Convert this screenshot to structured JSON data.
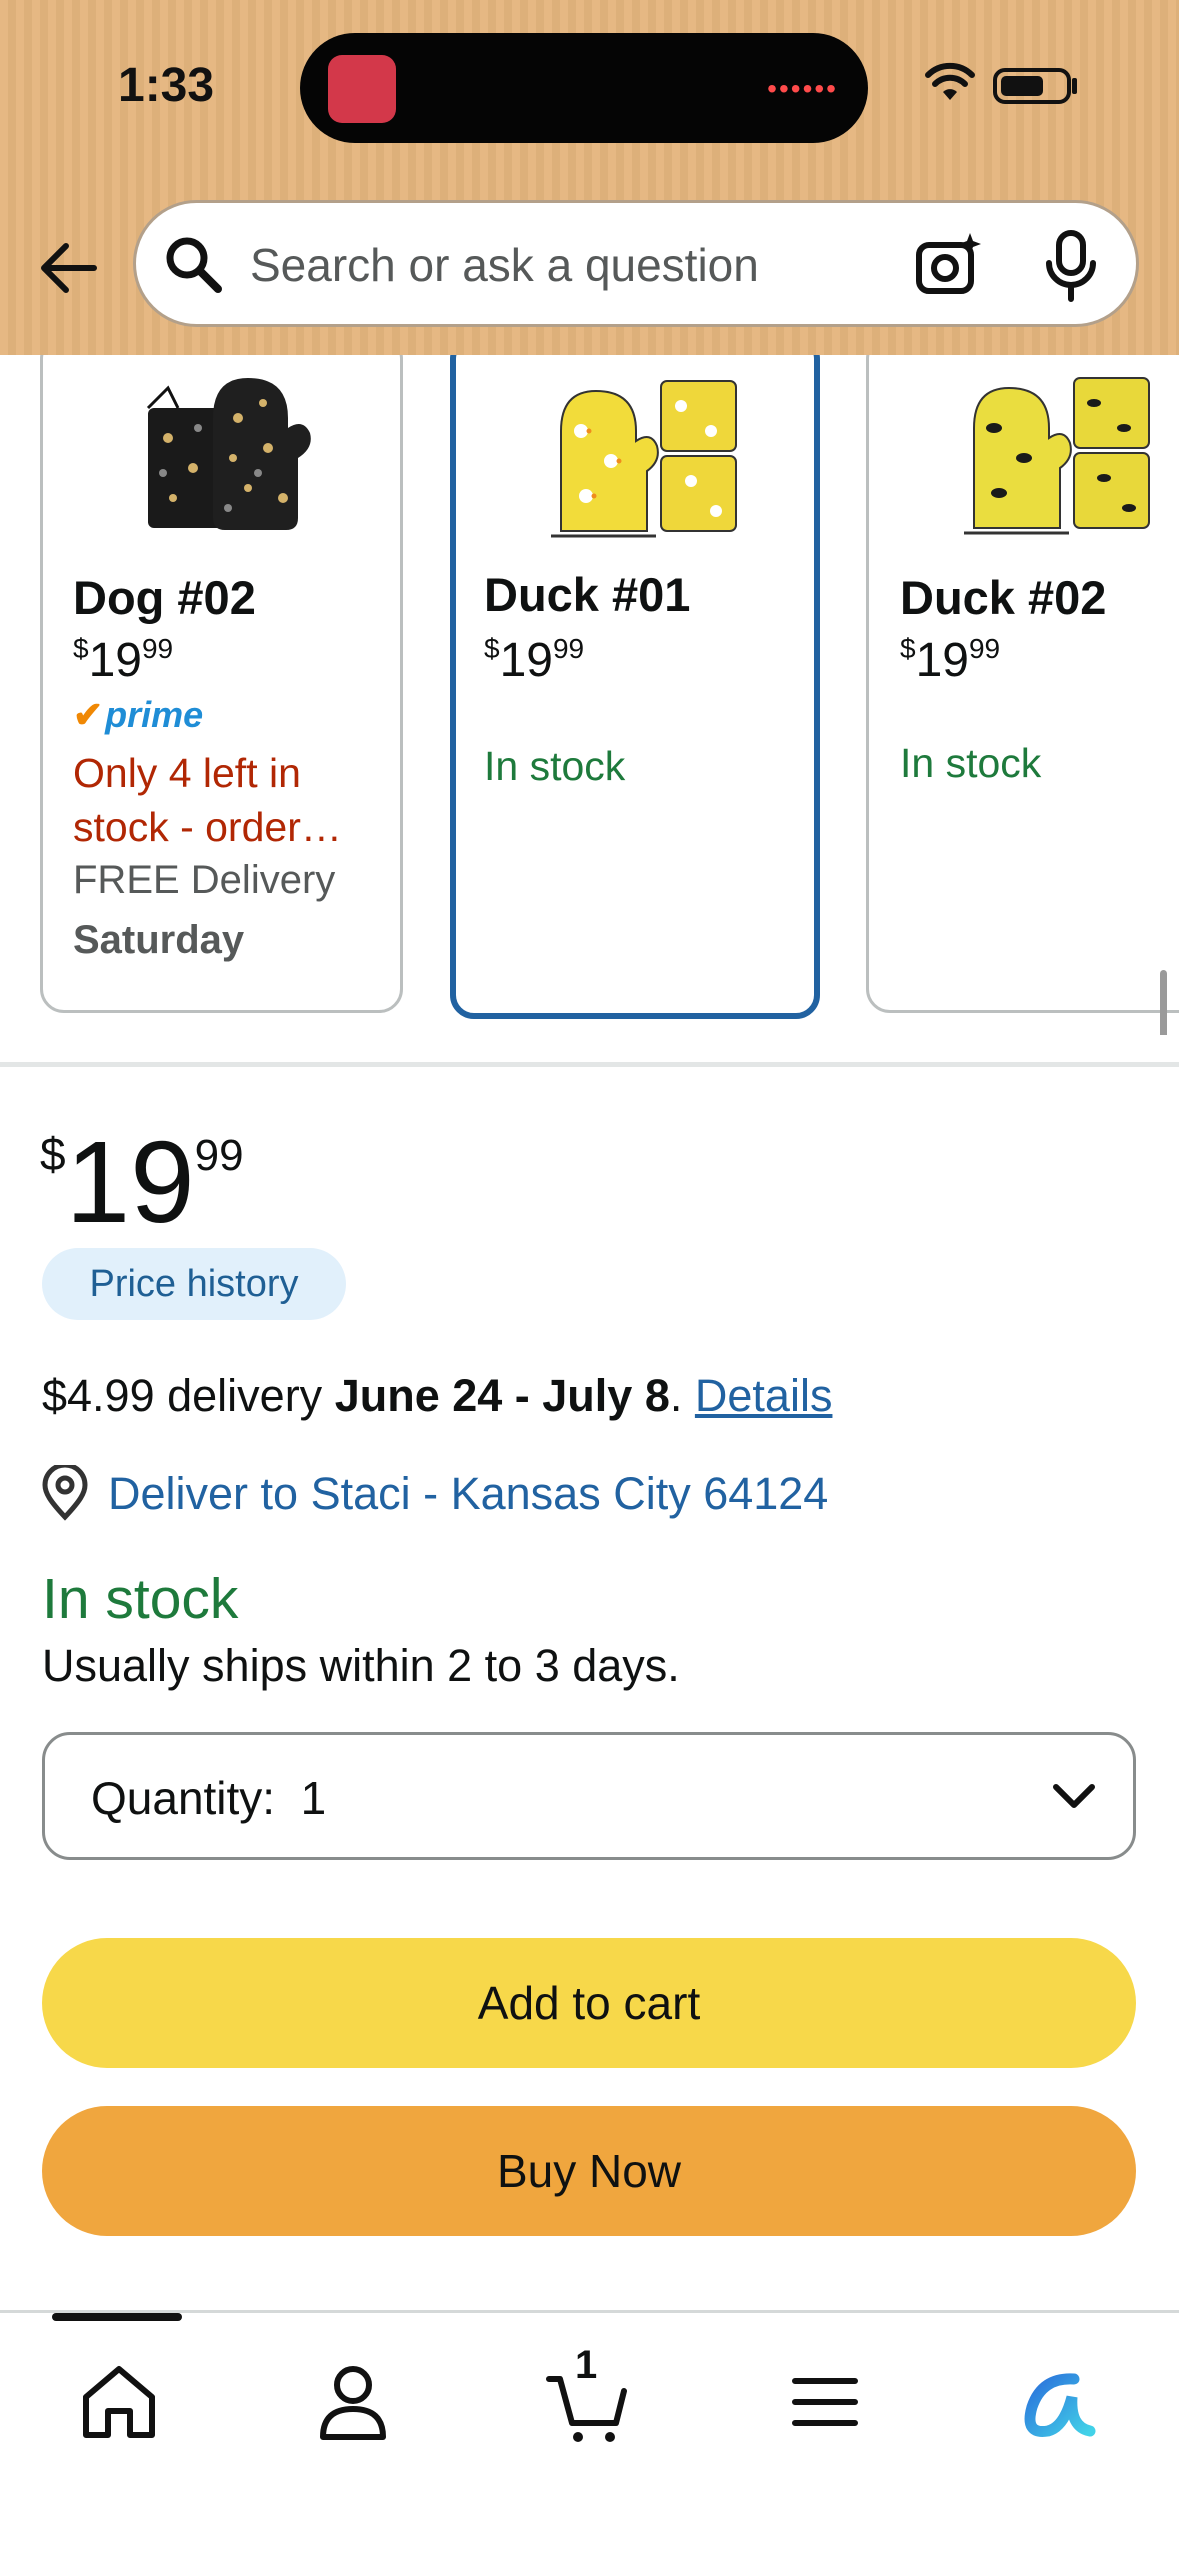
{
  "status_bar": {
    "time": "1:33"
  },
  "search": {
    "placeholder": "Search or ask a question"
  },
  "variants": [
    {
      "name": "Dog #02",
      "price_currency": "$",
      "price_whole": "19",
      "price_fraction": "99",
      "prime": "prime",
      "availability": "Only 4 left in stock - order…",
      "delivery": "FREE Delivery",
      "delivery_day": "Saturday"
    },
    {
      "name": "Duck #01",
      "price_currency": "$",
      "price_whole": "19",
      "price_fraction": "99",
      "availability": "In stock",
      "selected": true
    },
    {
      "name": "Duck #02",
      "price_currency": "$",
      "price_whole": "19",
      "price_fraction": "99",
      "availability": "In stock"
    }
  ],
  "price": {
    "currency": "$",
    "whole": "19",
    "fraction": "99"
  },
  "price_history_label": "Price history",
  "delivery": {
    "prefix": "$4.99 delivery",
    "dates": "June 24 - July 8",
    "suffix": ".",
    "details_link": "Details"
  },
  "deliver_to": "Deliver to Staci - Kansas City 64124",
  "stock": {
    "status": "In stock",
    "ships": "Usually ships within 2 to 3 days."
  },
  "quantity": {
    "label": "Quantity:",
    "value": "1"
  },
  "buttons": {
    "add_to_cart": "Add to cart",
    "buy_now": "Buy Now"
  },
  "nav": {
    "cart_count": "1",
    "items": [
      "home-icon",
      "account-icon",
      "cart-icon",
      "menu-icon",
      "rufus-icon"
    ]
  },
  "colors": {
    "header": "#e6b883",
    "link": "#2162a1",
    "in_stock": "#1e7a3c",
    "warning": "#b12704",
    "add_to_cart": "#f7d84a",
    "buy_now": "#f0a63e",
    "selected_border": "#2162a1"
  }
}
